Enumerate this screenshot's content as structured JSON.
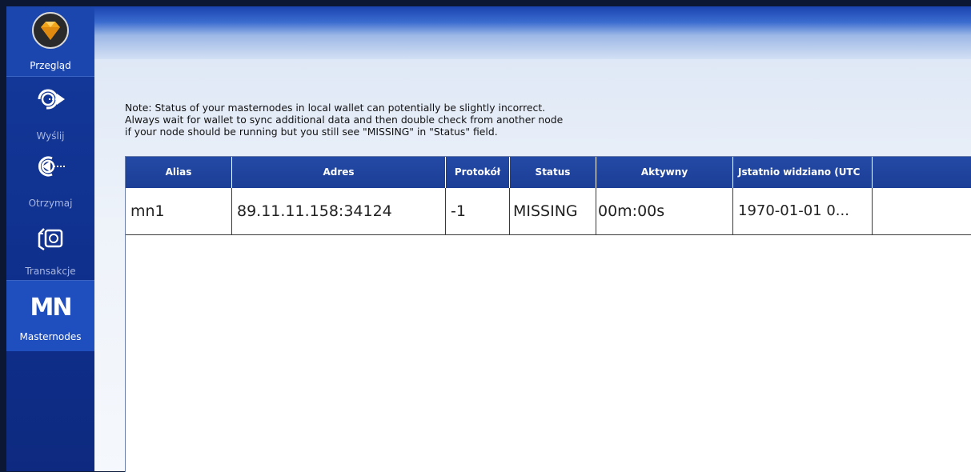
{
  "sidebar": {
    "items": [
      {
        "label": "Przegląd",
        "icon": "diamond-logo-icon"
      },
      {
        "label": "Wyślij",
        "icon": "send-coins-icon"
      },
      {
        "label": "Otrzymaj",
        "icon": "receive-coins-icon"
      },
      {
        "label": "Transakcje",
        "icon": "transactions-icon"
      },
      {
        "label": "Masternodes",
        "icon": "masternodes-icon",
        "icon_text": "MN"
      }
    ]
  },
  "note": {
    "line1": "Note: Status of your masternodes in local wallet can potentially be slightly incorrect.",
    "line2": "Always wait for wallet to sync additional data and then double check from another node",
    "line3": "if your node should be running but you still see \"MISSING\" in \"Status\" field."
  },
  "table": {
    "headers": [
      "Alias",
      "Adres",
      "Protokół",
      "Status",
      "Aktywny",
      "Jstatnio widziano (UTC"
    ],
    "rows": [
      [
        "mn1",
        "89.11.11.158:34124",
        "-1",
        "MISSING",
        "00m:00s",
        "1970-01-01 0..."
      ]
    ]
  },
  "colors": {
    "sidebar": "#0f2f8c",
    "header": "#1c3e96",
    "accent": "#1f4fbf"
  }
}
